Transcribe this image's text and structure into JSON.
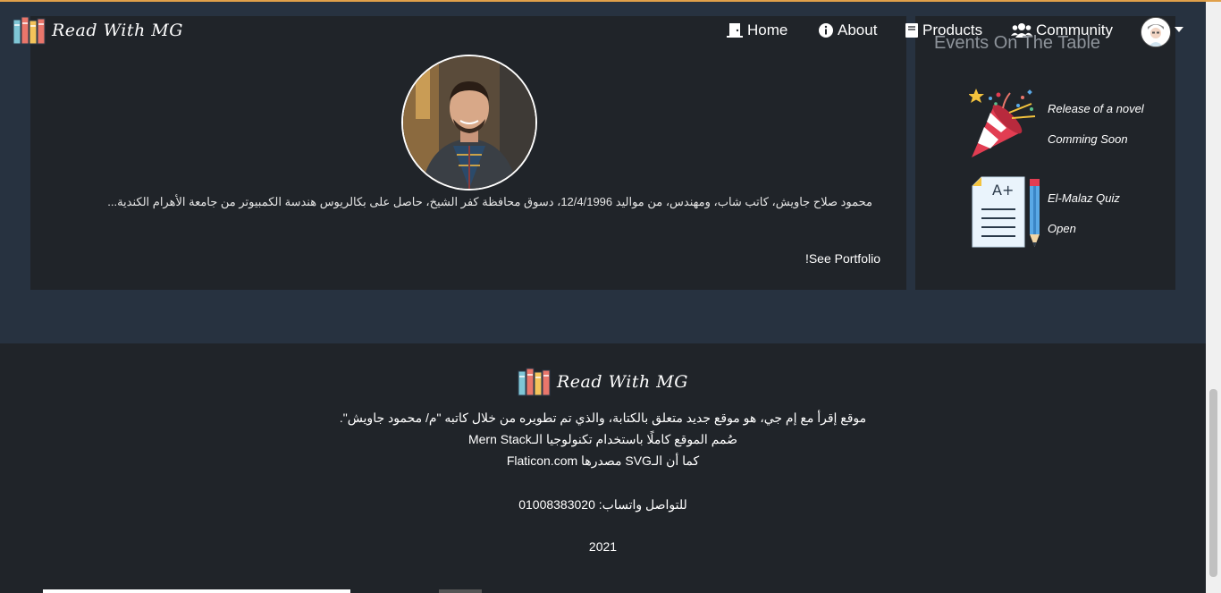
{
  "brand": {
    "name": "Read With MG"
  },
  "nav": {
    "home": "Home",
    "about": "About",
    "products": "Products",
    "community": "Community"
  },
  "profile": {
    "bio": "محمود صلاح جاويش، كاتب شاب، ومهندس، من مواليد 12/4/1996، دسوق محافظة كفر الشيخ، حاصل على بكالريوس هندسة الكمبيوتر من جامعة الأهرام الكندية...",
    "link": "!See Portfolio"
  },
  "events": {
    "title": "Events On The Table",
    "items": [
      {
        "line1": "Release of a novel",
        "line2": "Comming Soon",
        "icon": "party-popper-icon"
      },
      {
        "line1": "El-Malaz Quiz",
        "line2": "Open",
        "icon": "quiz-paper-icon"
      }
    ]
  },
  "footer": {
    "brand": "Read With MG",
    "line1": "موقع إقرأ مع إم جي، هو موقع جديد متعلق بالكتابة، والذي تم تطويره من خلال كاتبه \"م/ محمود جاويش\".",
    "line2": "صُمم الموقع كاملًا باستخدام تكنولوجيا الـMern Stack",
    "line3": "كما أن الـSVG مصدرها Flaticon.com",
    "contact": "للتواصل واتساب: 01008383020",
    "year": "2021"
  },
  "colors": {
    "page_bg": "#273240",
    "card_bg": "#202429",
    "accent": "#e0a04a"
  }
}
